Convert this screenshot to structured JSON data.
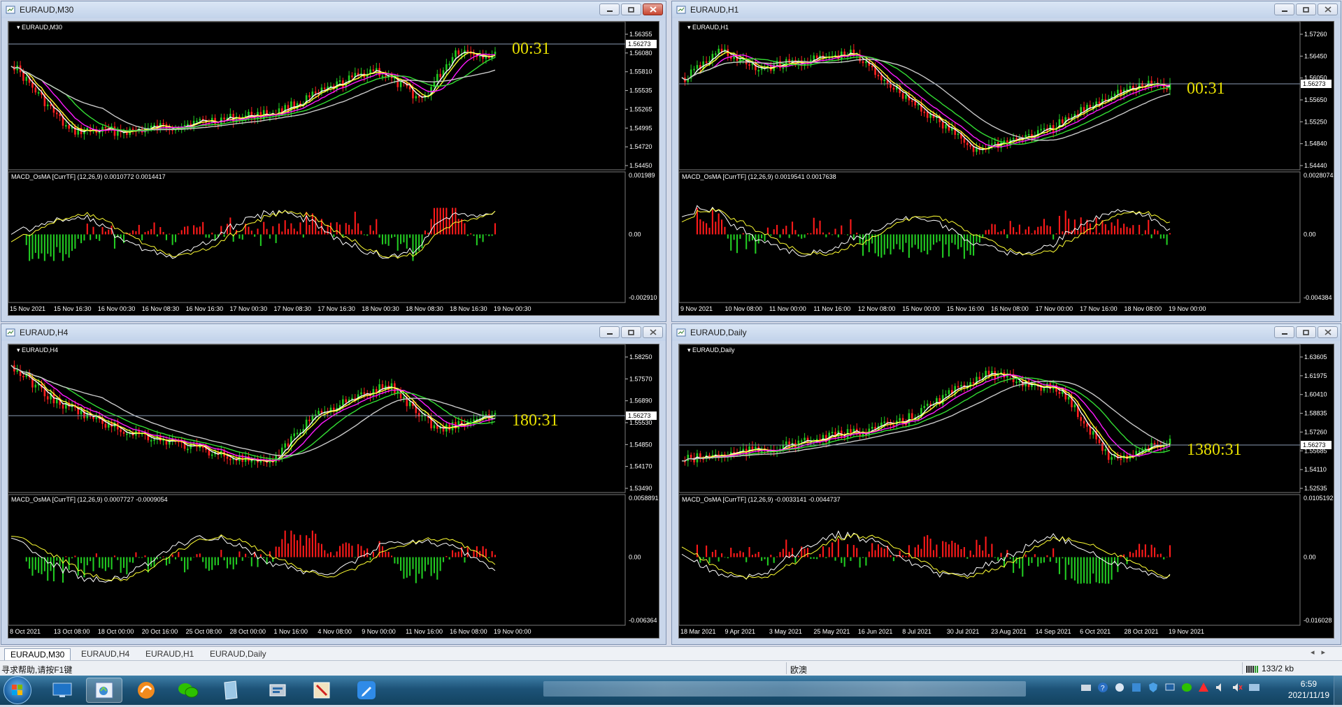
{
  "app": {
    "status_help": "寻求帮助,请按F1键",
    "status_region": "欧澳",
    "status_traffic": "133/2 kb",
    "clock_time": "6:59",
    "clock_date": "2021/11/19"
  },
  "tabs": [
    "EURAUD,M30",
    "EURAUD,H4",
    "EURAUD,H1",
    "EURAUD,Daily"
  ],
  "active_tab": 0,
  "colors": {
    "bullish_histogram": "#ff1a1a",
    "bearish_histogram": "#22cc22",
    "ma_white": "#ffffff",
    "ma_yellow": "#ffff33",
    "ma_magenta": "#ff1aff",
    "ma_green": "#33dd33",
    "ma_gray": "#c8c8c8",
    "countdown": "#e8e000",
    "bid_line": "#8b9bb4"
  },
  "windows": [
    {
      "title": "EURAUD,M30",
      "chart_label": "EURAUD,M30",
      "countdown": "00:31",
      "close_red": true,
      "current_price": "1.56273",
      "price_ticks": [
        "1.56355",
        "1.56080",
        "1.55810",
        "1.55535",
        "1.55265",
        "1.54995",
        "1.54720",
        "1.54450"
      ],
      "macd_label": "MACD_OsMA [CurrTF] (12,26,9) 0.0010772 0.0014417",
      "macd_ticks": [
        "0.001989",
        "0.00",
        "-0.002910"
      ],
      "time_labels": [
        "15 Nov 2021",
        "15 Nov 16:30",
        "16 Nov 00:30",
        "16 Nov 08:30",
        "16 Nov 16:30",
        "17 Nov 00:30",
        "17 Nov 08:30",
        "17 Nov 16:30",
        "18 Nov 00:30",
        "18 Nov 08:30",
        "18 Nov 16:30",
        "19 Nov 00:30"
      ]
    },
    {
      "title": "EURAUD,H1",
      "chart_label": "EURAUD,H1",
      "countdown": "00:31",
      "close_red": false,
      "current_price": "1.56273",
      "price_ticks": [
        "1.57260",
        "1.56450",
        "1.56050",
        "1.55650",
        "1.55250",
        "1.54840",
        "1.54440"
      ],
      "macd_label": "MACD_OsMA [CurrTF] (12,26,9) 0.0019541 0.0017638",
      "macd_ticks": [
        "0.0028074",
        "0.00",
        "-0.004384"
      ],
      "time_labels": [
        "9 Nov 2021",
        "10 Nov 08:00",
        "11 Nov 00:00",
        "11 Nov 16:00",
        "12 Nov 08:00",
        "15 Nov 00:00",
        "15 Nov 16:00",
        "16 Nov 08:00",
        "17 Nov 00:00",
        "17 Nov 16:00",
        "18 Nov 08:00",
        "19 Nov 00:00"
      ]
    },
    {
      "title": "EURAUD,H4",
      "chart_label": "EURAUD,H4",
      "countdown": "180:31",
      "close_red": false,
      "current_price": "1.56273",
      "price_ticks": [
        "1.58250",
        "1.57570",
        "1.56890",
        "1.55530",
        "1.54850",
        "1.54170",
        "1.53490"
      ],
      "macd_label": "MACD_OsMA [CurrTF] (12,26,9) 0.0007727 -0.0009054",
      "macd_ticks": [
        "0.0058891",
        "0.00",
        "-0.006364"
      ],
      "time_labels": [
        "8 Oct 2021",
        "13 Oct 08:00",
        "18 Oct 00:00",
        "20 Oct 16:00",
        "25 Oct 08:00",
        "28 Oct 00:00",
        "1 Nov 16:00",
        "4 Nov 08:00",
        "9 Nov 00:00",
        "11 Nov 16:00",
        "16 Nov 08:00",
        "19 Nov 00:00"
      ]
    },
    {
      "title": "EURAUD,Daily",
      "chart_label": "EURAUD,Daily",
      "countdown": "1380:31",
      "close_red": false,
      "current_price": "1.56273",
      "price_ticks": [
        "1.63605",
        "1.61975",
        "1.60410",
        "1.58835",
        "1.57260",
        "1.55685",
        "1.54110",
        "1.52535"
      ],
      "macd_label": "MACD_OsMA [CurrTF] (12,26,9) -0.0033141 -0.0044737",
      "macd_ticks": [
        "0.0105192",
        "0.00",
        "-0.016028"
      ],
      "time_labels": [
        "18 Mar 2021",
        "9 Apr 2021",
        "3 May 2021",
        "25 May 2021",
        "16 Jun 2021",
        "8 Jul 2021",
        "30 Jul 2021",
        "23 Aug 2021",
        "14 Sep 2021",
        "6 Oct 2021",
        "28 Oct 2021",
        "19 Nov 2021"
      ]
    }
  ]
}
